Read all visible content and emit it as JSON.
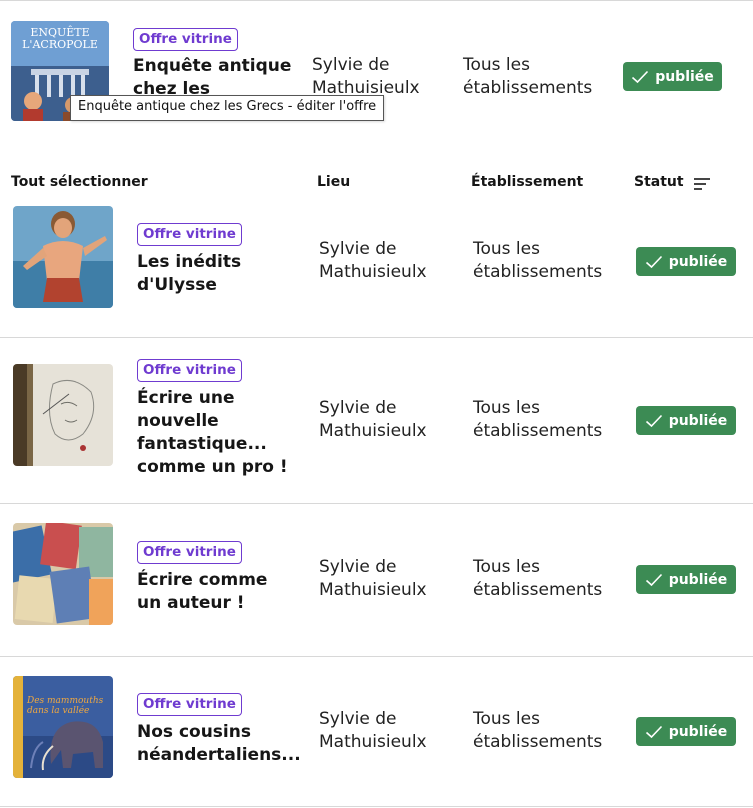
{
  "tooltip": "Enquête antique chez les Grecs - éditer l'offre",
  "header": {
    "select_all": "Tout sélectionner",
    "lieu": "Lieu",
    "etablissement": "Établissement",
    "statut": "Statut"
  },
  "colors": {
    "tag": "#6f3bd0",
    "badge": "#3c8b54",
    "divider": "#d8d8d8"
  },
  "rows": [
    {
      "tag": "Offre vitrine",
      "title": "Enquête antique chez les",
      "lieu": "Sylvie de Mathuisieulx",
      "etablissement": "Tous les établissements",
      "status": "publiée",
      "thumb_text": "ENQUÊTE L'ACROPOLE"
    },
    {
      "tag": "Offre vitrine",
      "title": "Les inédits d'Ulysse",
      "lieu": "Sylvie de Mathuisieulx",
      "etablissement": "Tous les établissements",
      "status": "publiée"
    },
    {
      "tag": "Offre vitrine",
      "title": "Écrire une nouvelle fantastique... comme un pro !",
      "lieu": "Sylvie de Mathuisieulx",
      "etablissement": "Tous les établissements",
      "status": "publiée"
    },
    {
      "tag": "Offre vitrine",
      "title": "Écrire comme un auteur !",
      "lieu": "Sylvie de Mathuisieulx",
      "etablissement": "Tous les établissements",
      "status": "publiée"
    },
    {
      "tag": "Offre vitrine",
      "title": "Nos cousins néandertaliens...",
      "lieu": "Sylvie de Mathuisieulx",
      "etablissement": "Tous les établissements",
      "status": "publiée",
      "thumb_text": "Des mammouths dans la vallée"
    }
  ]
}
